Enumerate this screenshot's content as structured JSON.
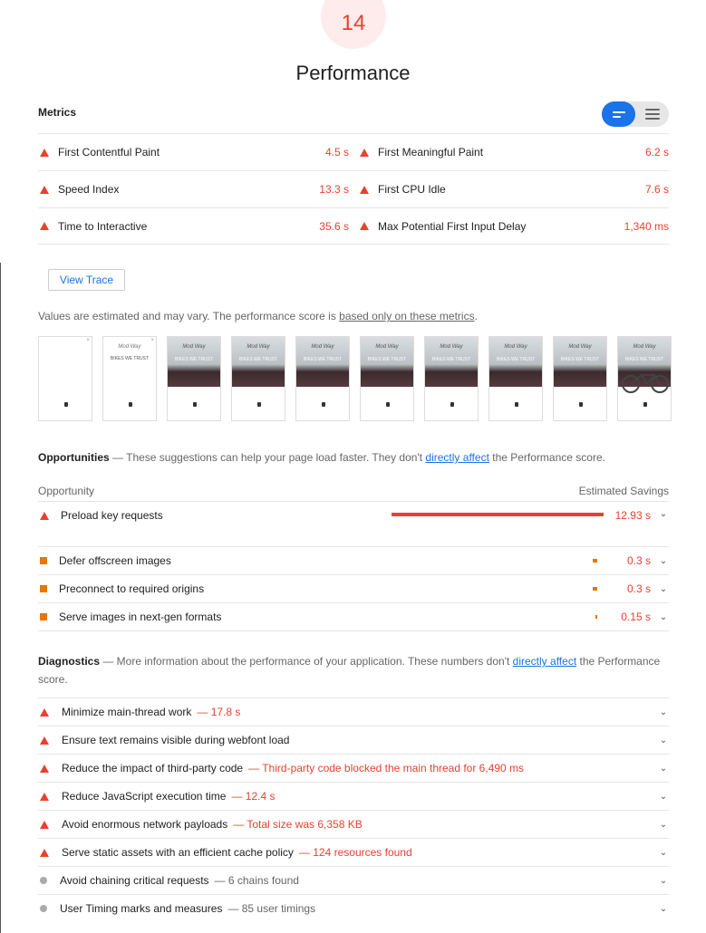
{
  "gauge": {
    "score": "14"
  },
  "category_title": "Performance",
  "metrics": {
    "heading": "Metrics",
    "rows": [
      [
        {
          "label": "First Contentful Paint",
          "value": "4.5 s"
        },
        {
          "label": "First Meaningful Paint",
          "value": "6.2 s"
        }
      ],
      [
        {
          "label": "Speed Index",
          "value": "13.3 s"
        },
        {
          "label": "First CPU Idle",
          "value": "7.6 s"
        }
      ],
      [
        {
          "label": "Time to Interactive",
          "value": "35.6 s"
        },
        {
          "label": "Max Potential First Input Delay",
          "value": "1,340 ms"
        }
      ]
    ]
  },
  "view_trace_label": "View Trace",
  "note": {
    "prefix": "Values are estimated and may vary. The performance score is ",
    "link": "based only on these metrics",
    "suffix": "."
  },
  "filmstrip": {
    "frames": 10,
    "script_text": "Mod Way",
    "tagline": "BIKES WE TRUST"
  },
  "opportunities": {
    "title": "Opportunities",
    "desc_prefix": " — These suggestions can help your page load faster. They don't ",
    "link": "directly affect",
    "desc_suffix": " the Performance score.",
    "col_left": "Opportunity",
    "col_right": "Estimated Savings",
    "items": [
      {
        "label": "Preload key requests",
        "savings": "12.93 s",
        "savings_fraction": 1.0,
        "severity": "fail"
      },
      {
        "label": "Defer offscreen images",
        "savings": "0.3 s",
        "savings_fraction": 0.023,
        "severity": "average"
      },
      {
        "label": "Preconnect to required origins",
        "savings": "0.3 s",
        "savings_fraction": 0.023,
        "severity": "average"
      },
      {
        "label": "Serve images in next-gen formats",
        "savings": "0.15 s",
        "savings_fraction": 0.012,
        "severity": "average"
      }
    ]
  },
  "diagnostics": {
    "title": "Diagnostics",
    "desc_prefix": " — More information about the performance of your application. These numbers don't ",
    "link": "directly affect",
    "desc_suffix": " the Performance score.",
    "items": [
      {
        "label": "Minimize main-thread work",
        "detail": "— 17.8 s",
        "severity": "fail"
      },
      {
        "label": "Ensure text remains visible during webfont load",
        "detail": "",
        "severity": "fail"
      },
      {
        "label": "Reduce the impact of third-party code",
        "detail": "— Third-party code blocked the main thread for 6,490 ms",
        "severity": "fail"
      },
      {
        "label": "Reduce JavaScript execution time",
        "detail": "— 12.4 s",
        "severity": "fail"
      },
      {
        "label": "Avoid enormous network payloads",
        "detail": "— Total size was 6,358 KB",
        "severity": "fail"
      },
      {
        "label": "Serve static assets with an efficient cache policy",
        "detail": "— 124 resources found",
        "severity": "fail"
      },
      {
        "label": "Avoid chaining critical requests",
        "detail": "— 6 chains found",
        "severity": "info"
      },
      {
        "label": "User Timing marks and measures",
        "detail": "— 85 user timings",
        "severity": "info"
      }
    ]
  },
  "colors": {
    "fail": "#e8412f",
    "average": "#e67700",
    "info": "#aaaaaa",
    "link": "#1a73e8"
  },
  "icons": {
    "fail": "triangle-icon",
    "average": "square-icon",
    "info": "circle-icon",
    "expand": "chevron-down-icon"
  }
}
